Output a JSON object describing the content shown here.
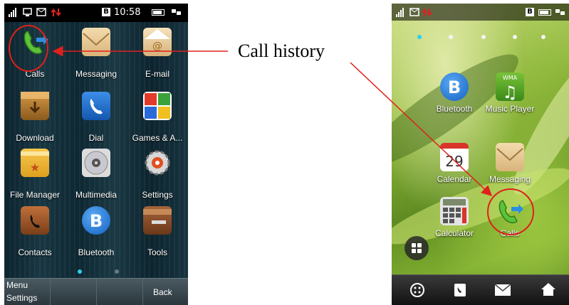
{
  "left_phone": {
    "status": {
      "time": "10:58",
      "b_badge": "B"
    },
    "apps": [
      {
        "label": "Calls",
        "icon": "phone-call-icon"
      },
      {
        "label": "Messaging",
        "icon": "envelope-icon"
      },
      {
        "label": "E-mail",
        "icon": "email-envelope-icon"
      },
      {
        "label": "Download",
        "icon": "download-box-icon"
      },
      {
        "label": "Dial",
        "icon": "dial-phone-icon"
      },
      {
        "label": "Games & A...",
        "icon": "games-grid-icon"
      },
      {
        "label": "File Manager",
        "icon": "folder-icon"
      },
      {
        "label": "Multimedia",
        "icon": "disc-icon"
      },
      {
        "label": "Settings",
        "icon": "gear-icon"
      },
      {
        "label": "Contacts",
        "icon": "contacts-book-icon"
      },
      {
        "label": "Bluetooth",
        "icon": "bluetooth-icon"
      },
      {
        "label": "Tools",
        "icon": "toolbox-icon"
      }
    ],
    "softkeys": {
      "left_top": "Menu",
      "left_bottom": "Settings",
      "right": "Back"
    }
  },
  "right_phone": {
    "status": {
      "b_badge": "B"
    },
    "apps": [
      {
        "label": "Bluetooth",
        "icon": "bluetooth-icon"
      },
      {
        "label": "Music Player",
        "icon": "music-note-icon",
        "badge": "WMA"
      },
      {
        "label": "Calendar",
        "icon": "calendar-icon",
        "day": "29"
      },
      {
        "label": "Messaging",
        "icon": "envelope-icon"
      },
      {
        "label": "Calculator",
        "icon": "calculator-icon"
      },
      {
        "label": "Calls",
        "icon": "phone-call-icon"
      }
    ],
    "dock": [
      "dialpad-icon",
      "contacts-icon",
      "message-icon",
      "home-icon"
    ]
  },
  "annotation": {
    "label": "Call history",
    "color": "#e0201a"
  }
}
